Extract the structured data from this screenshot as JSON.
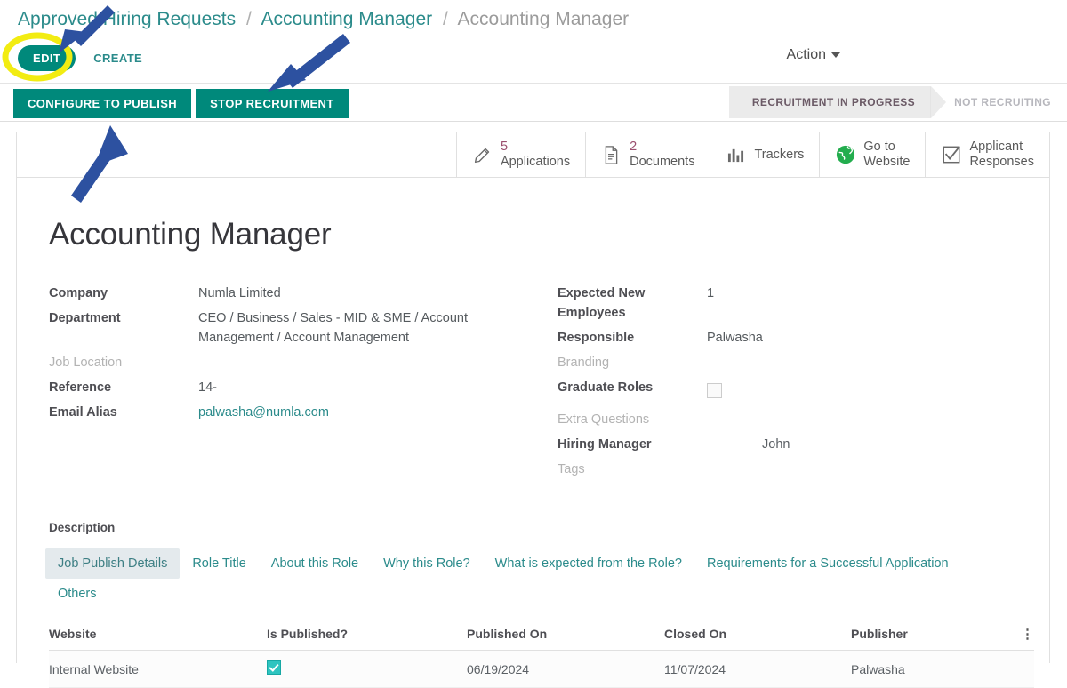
{
  "breadcrumb": {
    "items": [
      {
        "label": "Approved Hiring Requests",
        "current": false
      },
      {
        "label": "Accounting Manager",
        "current": false
      },
      {
        "label": "Accounting Manager",
        "current": true
      }
    ],
    "separator": "/"
  },
  "toolbar": {
    "edit_label": "EDIT",
    "create_label": "CREATE",
    "action_label": "Action"
  },
  "actions": {
    "configure_label": "CONFIGURE TO PUBLISH",
    "stop_label": "STOP RECRUITMENT"
  },
  "status": {
    "active": "RECRUITMENT IN PROGRESS",
    "inactive": "NOT RECRUITING"
  },
  "stat_buttons": [
    {
      "icon": "pencil-icon",
      "count": "5",
      "label": "Applications"
    },
    {
      "icon": "document-icon",
      "count": "2",
      "label": "Documents"
    },
    {
      "icon": "bar-chart-icon",
      "count": "",
      "label": "Trackers"
    },
    {
      "icon": "globe-icon",
      "count": "",
      "label": "Go to\nWebsite",
      "line1": "Go to",
      "line2": "Website"
    },
    {
      "icon": "checkbox-check-icon",
      "count": "",
      "label": "Applicant\nResponses",
      "line1": "Applicant",
      "line2": "Responses"
    }
  ],
  "record": {
    "title": "Accounting Manager",
    "fields_left": [
      {
        "label": "Company",
        "value": "Numla Limited",
        "muted_label": false,
        "type": "text"
      },
      {
        "label": "Department",
        "value": "CEO / Business / Sales - MID & SME / Account Management / Account Management",
        "muted_label": false,
        "type": "text"
      },
      {
        "label": "Job Location",
        "value": "",
        "muted_label": true,
        "type": "text"
      },
      {
        "label": "Reference",
        "value": "14-",
        "muted_label": false,
        "type": "text"
      },
      {
        "label": "Email Alias",
        "value": "palwasha@numla.com",
        "muted_label": false,
        "type": "link"
      }
    ],
    "fields_right": [
      {
        "label": "Expected New Employees",
        "value": "1",
        "muted_label": false,
        "type": "text"
      },
      {
        "label": "Responsible",
        "value": "Palwasha",
        "muted_label": false,
        "type": "text"
      },
      {
        "label": "Branding",
        "value": "",
        "muted_label": true,
        "type": "text"
      },
      {
        "label": "Graduate Roles",
        "value": "",
        "muted_label": false,
        "type": "checkbox",
        "checked": false
      },
      {
        "label": "Extra Questions",
        "value": "",
        "muted_label": true,
        "type": "text"
      },
      {
        "label": "Hiring Manager",
        "value": "John",
        "muted_label": false,
        "type": "tag"
      },
      {
        "label": "Tags",
        "value": "",
        "muted_label": true,
        "type": "text"
      }
    ]
  },
  "description": {
    "section_label": "Description",
    "tabs": [
      {
        "label": "Job Publish Details",
        "active": true
      },
      {
        "label": "Role Title",
        "active": false
      },
      {
        "label": "About this Role",
        "active": false
      },
      {
        "label": "Why this Role?",
        "active": false
      },
      {
        "label": "What is expected from the Role?",
        "active": false
      },
      {
        "label": "Requirements for a Successful Application",
        "active": false
      },
      {
        "label": "Others",
        "active": false
      }
    ]
  },
  "table": {
    "columns": [
      "Website",
      "Is Published?",
      "Published On",
      "Closed On",
      "Publisher"
    ],
    "options_icon": "vertical-dots-icon",
    "rows": [
      {
        "website": "Internal Website",
        "is_published": true,
        "published_on": "06/19/2024",
        "closed_on": "11/07/2024",
        "publisher": "Palwasha"
      }
    ]
  },
  "annotations": {
    "highlight_color": "#f2ec12",
    "arrow_color": "#2d51a0",
    "arrow_count": 3,
    "ellipse_target": "EDIT"
  },
  "colors": {
    "accent_teal": "#00897b",
    "link_teal": "#2b8b8b",
    "count_magenta": "#9b4f6e",
    "status_active_bg": "#ebebeb"
  }
}
